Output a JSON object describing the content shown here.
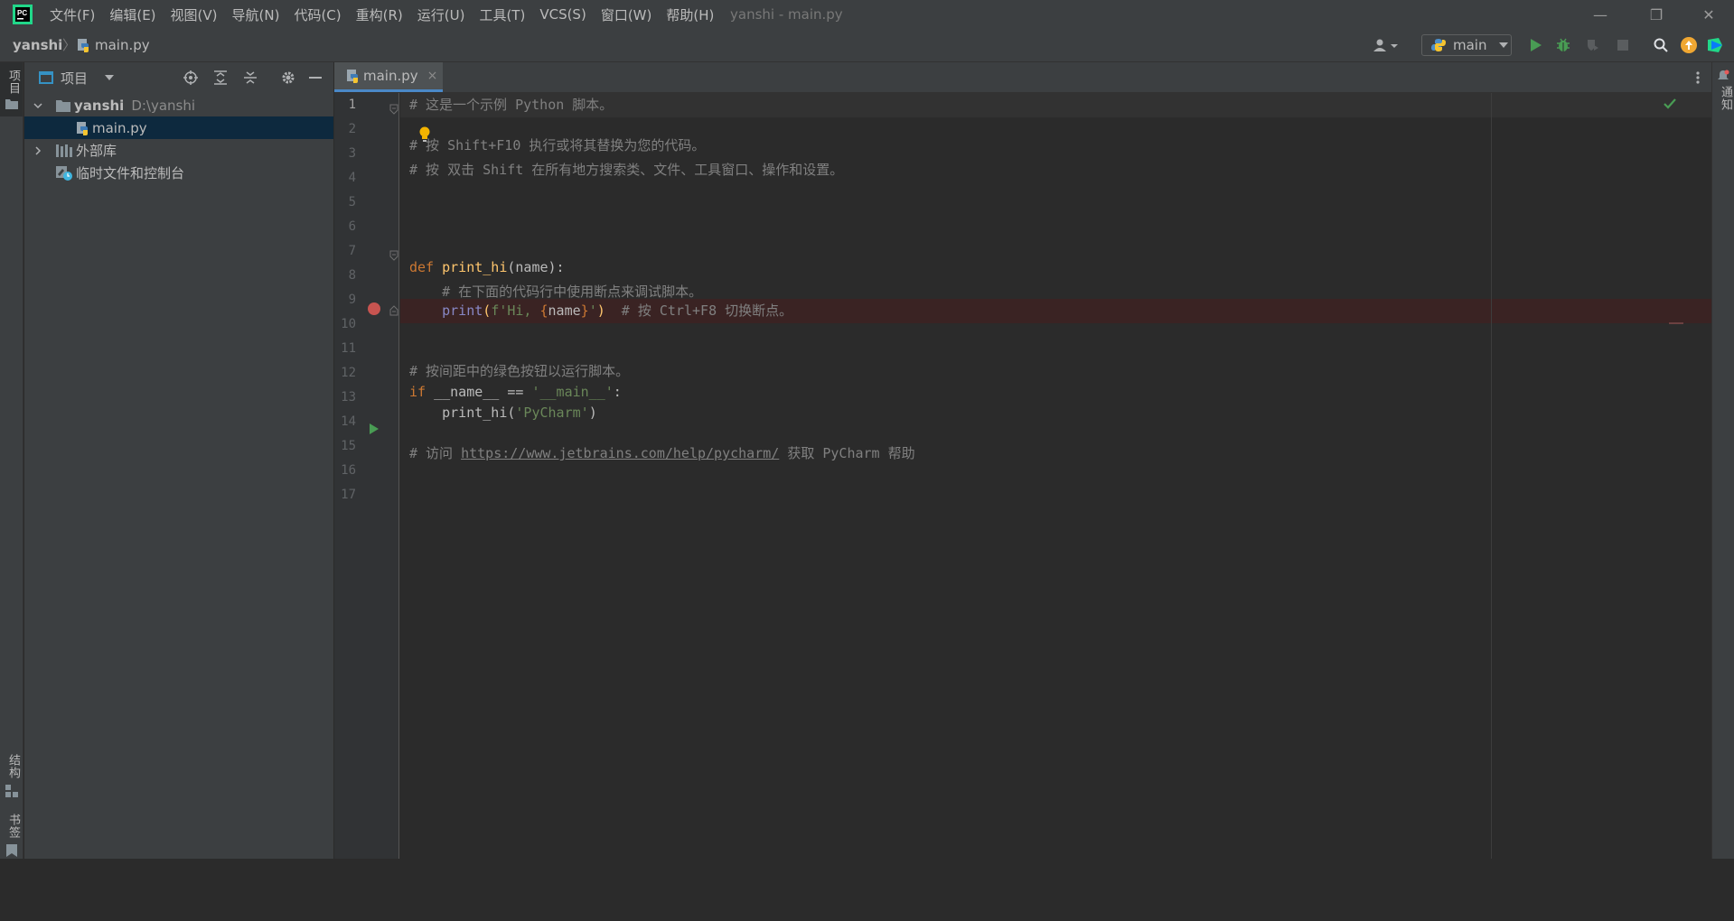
{
  "window": {
    "title": "yanshi - main.py",
    "menu": [
      "文件(F)",
      "编辑(E)",
      "视图(V)",
      "导航(N)",
      "代码(C)",
      "重构(R)",
      "运行(U)",
      "工具(T)",
      "VCS(S)",
      "窗口(W)",
      "帮助(H)"
    ],
    "controls": {
      "minimize": "—",
      "restore": "❐",
      "close": "✕"
    }
  },
  "breadcrumb": {
    "project": "yanshi",
    "file": "main.py"
  },
  "run_config": {
    "name": "main"
  },
  "left_strip": {
    "project_label": "项目",
    "structure_label": "结构",
    "bookmarks_label": "书签"
  },
  "right_strip": {
    "notifications_label": "通知"
  },
  "project_panel": {
    "title": "项目",
    "tree": {
      "root_name": "yanshi",
      "root_path": "D:\\yanshi",
      "file": "main.py",
      "external_libs": "外部库",
      "scratches": "临时文件和控制台"
    }
  },
  "editor": {
    "tab_label": "main.py",
    "tab_close": "×",
    "line_numbers": [
      "1",
      "2",
      "3",
      "4",
      "5",
      "6",
      "7",
      "8",
      "9",
      "10",
      "11",
      "12",
      "13",
      "14",
      "15",
      "16",
      "17"
    ],
    "line1": "# 这是一个示例 Python 脚本。",
    "line3": "# 按 Shift+F10 执行或将其替换为您的代码。",
    "line4": "# 按 双击 Shift 在所有地方搜索类、文件、工具窗口、操作和设置。",
    "line7_kw": "def",
    "line7_fn": "print_hi",
    "line7_rest": "(name):",
    "line8": "    # 在下面的代码行中使用断点来调试脚本。",
    "line9_indent": "    ",
    "line9_fn": "print",
    "line9_open": "(",
    "line9_fpre": "f'Hi, ",
    "line9_lbrace": "{",
    "line9_var": "name",
    "line9_rbrace": "}",
    "line9_fpost": "'",
    "line9_close": ")",
    "line9_comment": "  # 按 Ctrl+F8 切换断点。",
    "line12": "# 按间距中的绿色按钮以运行脚本。",
    "line13_kw": "if",
    "line13_mid": " __name__ == ",
    "line13_str": "'__main__'",
    "line13_end": ":",
    "line14_pre": "    print_hi(",
    "line14_str": "'PyCharm'",
    "line14_end": ")",
    "line16_pre": "# 访问 ",
    "line16_link": "https://www.jetbrains.com/help/pycharm/",
    "line16_post": " 获取 PyCharm 帮助"
  },
  "colors": {
    "accent": "#4a88c7",
    "keyword": "#cc7832",
    "function": "#ffc66d",
    "comment": "#808080",
    "string": "#6a8759",
    "breakpoint": "#c75450",
    "run": "#499c54"
  },
  "icons": [
    "pycharm-logo-icon",
    "user-icon",
    "python-icon",
    "run-icon",
    "debug-icon",
    "coverage-icon",
    "stop-icon",
    "search-icon",
    "update-icon",
    "toolbox-icon",
    "locate-icon",
    "expand-icon",
    "collapse-icon",
    "gear-icon",
    "hide-icon",
    "folder-icon",
    "library-icon",
    "scratch-icon",
    "bulb-icon",
    "breakpoint-icon",
    "check-icon",
    "more-icon",
    "bell-icon"
  ]
}
